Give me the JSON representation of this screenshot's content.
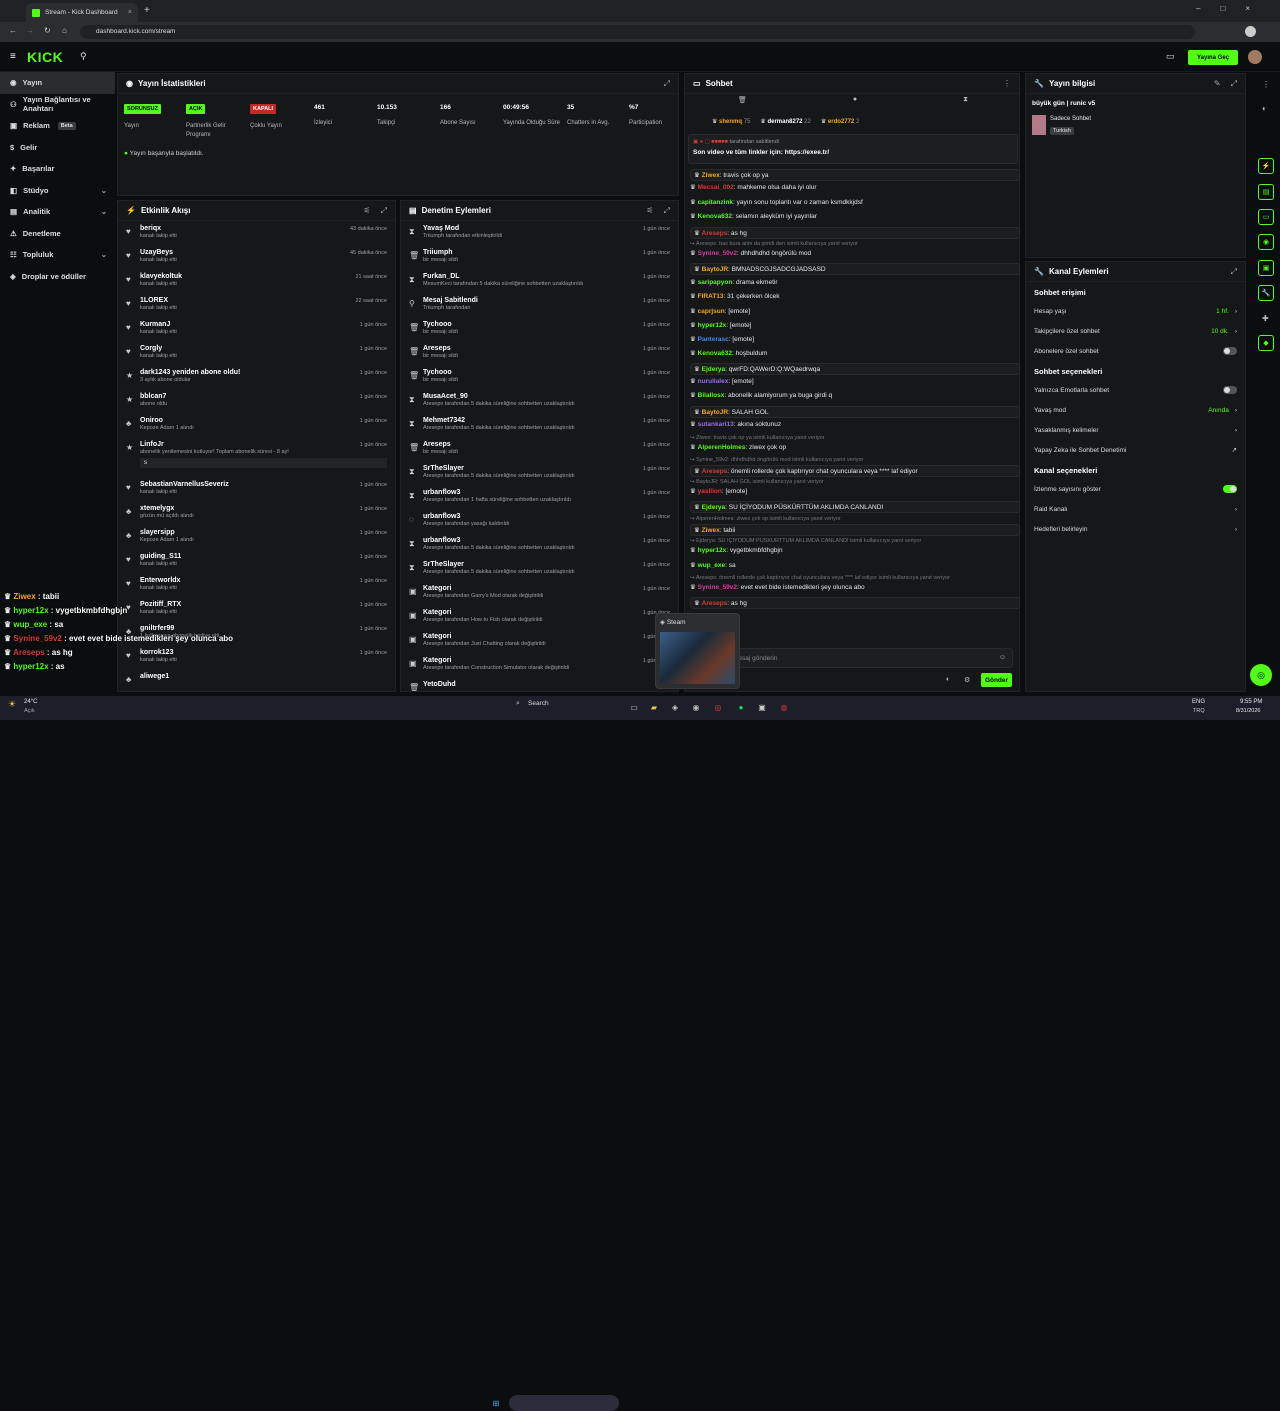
{
  "browser": {
    "tab_title": "Stream - Kick Dashboard",
    "url": "dashboard.kick.com/stream"
  },
  "header": {
    "logo": "KICK",
    "go_live": "Yayına Geç"
  },
  "sidebar": {
    "items": [
      {
        "label": "Yayın",
        "active": true
      },
      {
        "label": "Yayın Bağlantısı ve Anahtarı"
      },
      {
        "label": "Reklam",
        "badge": "Beta"
      },
      {
        "label": "Gelir"
      },
      {
        "label": "Başarılar"
      },
      {
        "label": "Stüdyo",
        "chevron": true
      },
      {
        "label": "Analitik",
        "chevron": true
      },
      {
        "label": "Denetleme"
      },
      {
        "label": "Topluluk",
        "chevron": true
      },
      {
        "label": "Droplar ve ödüller"
      }
    ]
  },
  "stats": {
    "title": "Yayın İstatistikleri",
    "status": "Yayın başarıyla başlatıldı.",
    "items": [
      {
        "value": "SORUNSUZ",
        "label": "Yayın",
        "kind": "green"
      },
      {
        "value": "AÇIK",
        "label": "Partnerlik Gelir Programı",
        "kind": "green"
      },
      {
        "value": "KAPALI",
        "label": "Çoklu Yayın",
        "kind": "red"
      },
      {
        "value": "461",
        "label": "İzleyici"
      },
      {
        "value": "10.153",
        "label": "Takipçi"
      },
      {
        "value": "166",
        "label": "Abone Sayısı"
      },
      {
        "value": "00:49:56",
        "label": "Yayında Olduğu Süre"
      },
      {
        "value": "35",
        "label": "Chatters in Avg."
      },
      {
        "value": "%7",
        "label": "Participation"
      }
    ]
  },
  "activity": {
    "title": "Etkinlik Akışı",
    "items": [
      {
        "name": "beriqx",
        "sub": "kanalı takip etti",
        "time": "43 dakika önce",
        "icon": "heart"
      },
      {
        "name": "UzayBeys",
        "sub": "kanalı takip etti",
        "time": "45 dakika önce",
        "icon": "heart"
      },
      {
        "name": "klavyekoltuk",
        "sub": "kanalı takip etti",
        "time": "21 saat önce",
        "icon": "heart"
      },
      {
        "name": "1LOREX",
        "sub": "kanalı takip etti",
        "time": "22 saat önce",
        "icon": "heart"
      },
      {
        "name": "KurmanJ",
        "sub": "kanalı takip etti",
        "time": "1 gün önce",
        "icon": "heart"
      },
      {
        "name": "Corgly",
        "sub": "kanalı takip etti",
        "time": "1 gün önce",
        "icon": "heart"
      },
      {
        "name": "dark1243 yeniden abone oldu!",
        "sub": "3 aylık abone oldular",
        "time": "1 gün önce",
        "icon": "star"
      },
      {
        "name": "bblcan7",
        "sub": "abone oldu",
        "time": "1 gün önce",
        "icon": "star"
      },
      {
        "name": "Oniroo",
        "sub": "Kepoze Adam 1 alındı",
        "time": "1 gün önce",
        "icon": "gift"
      },
      {
        "name": "LinfoJr",
        "sub": "abonelik yenilemesini kutluyor! Toplam abonelik süresi - 8 ay!",
        "time": "1 gün önce",
        "icon": "star",
        "msg": "s"
      },
      {
        "name": "SebastianVarnellusSeveriz",
        "sub": "kanalı takip etti",
        "time": "1 gün önce",
        "icon": "heart"
      },
      {
        "name": "xtemelygx",
        "sub": "gözün mü açıldı alındı",
        "time": "1 gün önce",
        "icon": "gift"
      },
      {
        "name": "slayersipp",
        "sub": "Kepoze Adam 1 alındı",
        "time": "1 gün önce",
        "icon": "gift"
      },
      {
        "name": "guiding_S11",
        "sub": "kanalı takip etti",
        "time": "1 gün önce",
        "icon": "heart"
      },
      {
        "name": "Enterworldx",
        "sub": "kanalı takip etti",
        "time": "1 gün önce",
        "icon": "heart"
      },
      {
        "name": "Pozitiff_RTX",
        "sub": "kanalı takip etti",
        "time": "1 gün önce",
        "icon": "heart"
      },
      {
        "name": "gniltrfer99",
        "sub": "1 kullanıcıya abonelik hediye etti.",
        "time": "1 gün önce",
        "icon": "gift"
      },
      {
        "name": "korrok123",
        "sub": "kanalı takip etti",
        "time": "1 gün önce",
        "icon": "heart"
      },
      {
        "name": "aliwege1",
        "sub": "",
        "time": "",
        "icon": "gift"
      }
    ]
  },
  "mod": {
    "title": "Denetim Eylemleri",
    "items": [
      {
        "name": "Yavaş Mod",
        "sub": "Triiumph tarafından etkinleştirildi",
        "time": "1 gün önce",
        "icon": "slow"
      },
      {
        "name": "Triiumph",
        "sub": "bir mesajı sildi",
        "time": "1 gün önce",
        "icon": "trash"
      },
      {
        "name": "Furkan_DL",
        "sub": "MesumKeci tarafından 5 dakika süreliğine sohbetten uzaklaştırıldı",
        "time": "1 gün önce",
        "icon": "timer"
      },
      {
        "name": "Mesaj Sabitlendi",
        "sub": "Triiumph tarafından",
        "time": "1 gün önce",
        "icon": "pin"
      },
      {
        "name": "Tychooo",
        "sub": "bir mesajı sildi",
        "time": "1 gün önce",
        "icon": "trash"
      },
      {
        "name": "Areseps",
        "sub": "bir mesajı sildi",
        "time": "1 gün önce",
        "icon": "trash"
      },
      {
        "name": "Tychooo",
        "sub": "bir mesajı sildi",
        "time": "1 gün önce",
        "icon": "trash"
      },
      {
        "name": "MusaAcet_90",
        "sub": "Areseps tarafından 5 dakika süreliğine sohbetten uzaklaştırıldı",
        "time": "1 gün önce",
        "icon": "timer"
      },
      {
        "name": "Mehmet7342",
        "sub": "Areseps tarafından 5 dakika süreliğine sohbetten uzaklaştırıldı",
        "time": "1 gün önce",
        "icon": "timer"
      },
      {
        "name": "Areseps",
        "sub": "bir mesajı sildi",
        "time": "1 gün önce",
        "icon": "trash"
      },
      {
        "name": "SrTheSlayer",
        "sub": "Areseps tarafından 5 dakika süreliğine sohbetten uzaklaştırıldı",
        "time": "1 gün önce",
        "icon": "timer"
      },
      {
        "name": "urbanflow3",
        "sub": "Areseps tarafından 1 hafta süreliğine sohbetten uzaklaştırıldı",
        "time": "1 gün önce",
        "icon": "timer"
      },
      {
        "name": "urbanflow3",
        "sub": "Areseps tarafından yasağı kaldırıldı",
        "time": "1 gün önce",
        "icon": "unban"
      },
      {
        "name": "urbanflow3",
        "sub": "Areseps tarafından 5 dakika süreliğine sohbetten uzaklaştırıldı",
        "time": "1 gün önce",
        "icon": "timer"
      },
      {
        "name": "SrTheSlayer",
        "sub": "Areseps tarafından 5 dakika süreliğine sohbetten uzaklaştırıldı",
        "time": "1 gün önce",
        "icon": "timer"
      },
      {
        "name": "Kategori",
        "sub": "Areseps tarafından Garry's Mod olarak değiştirildi",
        "time": "1 gün önce",
        "icon": "cat"
      },
      {
        "name": "Kategori",
        "sub": "Areseps tarafından How to Fish olarak değiştirildi",
        "time": "1 gün önce",
        "icon": "cat"
      },
      {
        "name": "Kategori",
        "sub": "Areseps tarafından Just Chatting olarak değiştirildi",
        "time": "1 gün önce",
        "icon": "cat"
      },
      {
        "name": "Kategori",
        "sub": "Areseps tarafından Construction Simulator olarak değiştirildi",
        "time": "1 gün önce",
        "icon": "cat"
      },
      {
        "name": "YetoDuhd",
        "sub": "",
        "time": "",
        "icon": "trash"
      }
    ]
  },
  "chat": {
    "title": "Sohbet",
    "top": [
      {
        "name": "shenmq",
        "n": "75",
        "color": "#f5a623"
      },
      {
        "name": "derman8272",
        "n": "22",
        "color": "#fff"
      },
      {
        "name": "erdo2772",
        "n": "2",
        "color": "#f5a623"
      }
    ],
    "pinned_by": "tarafından sabitlendi",
    "pinned": "Son video ve tüm linkler için: https://exee.tr/",
    "messages": [
      {
        "u": "Ziwex",
        "c": "#f5a623",
        "m": "travis çok op ya",
        "hl": true
      },
      {
        "u": "Mecsai_002",
        "c": "#d63a3a",
        "m": "mahkeme olsa daha iyi olur"
      },
      {
        "u": "capitanzink",
        "c": "#53fc18",
        "m": "yayın sonu toplantı var o zaman ksmdkkjdsf"
      },
      {
        "u": "Kenova632",
        "c": "#53fc18",
        "m": "selamın aleyküm iyi yayınlar"
      },
      {
        "u": "Areseps",
        "c": "#d63a3a",
        "m": "as hg",
        "hl": true
      },
      {
        "sys": "Areseps: bas bura atim da şimdi den isimli kullanıcıya yanıt veriyor"
      },
      {
        "u": "Synine_59v2",
        "c": "#d63aa6",
        "m": "dhhdhdhd öngörülü mod"
      },
      {
        "u": "BaytoJR",
        "c": "#f5a623",
        "m": "BMNADSCGJSADCGJADSASD",
        "hl": true
      },
      {
        "u": "saripapyon",
        "c": "#53fc18",
        "m": "drama ekmetir"
      },
      {
        "u": "FIRAT13",
        "c": "#f5a623",
        "m": "31 çekerken ölcek"
      },
      {
        "u": "caprjsun",
        "c": "#f5a623",
        "m": "[emote]"
      },
      {
        "u": "hyper12x",
        "c": "#53fc18",
        "m": "[emote]"
      },
      {
        "u": "Panterasc",
        "c": "#3a8cf5",
        "m": "[emote]"
      },
      {
        "u": "Kenova632",
        "c": "#53fc18",
        "m": "hoşbuldum"
      },
      {
        "u": "Ejderya",
        "c": "#53fc18",
        "m": "qwrFD:QAWerD:Q:WQaedrwqa",
        "hl": true
      },
      {
        "u": "nurullalex",
        "c": "#9b6bf5",
        "m": "[emote]"
      },
      {
        "u": "Bilallosx",
        "c": "#53fc18",
        "m": "abonelik alamiyorum ya buga girdi q"
      },
      {
        "u": "BaytoJR",
        "c": "#f5a623",
        "m": "SALAH GOL",
        "hl": true
      },
      {
        "u": "sutankari13",
        "c": "#9b6bf5",
        "m": "akına soktunuz"
      },
      {
        "sys": "Ziwex: travis çok op ya isimli kullanıcıya yanıt veriyor"
      },
      {
        "u": "AlperenHolmes",
        "c": "#53fc18",
        "m": "ziwex çok op"
      },
      {
        "sys": "Synine_59v2: dhhdhdhd öngörülü mod isimli kullanıcıya yanıt veriyor"
      },
      {
        "u": "Areseps",
        "c": "#d63a3a",
        "m": "önemli rollerde çok kaptırıyor chat oyunculara veya **** laf ediyor",
        "hl": true
      },
      {
        "sys": "BaytoJR: SALAH GOL isimli kullanıcıya yanıt veriyor"
      },
      {
        "u": "yasllion",
        "c": "#d63a3a",
        "m": "[emote]"
      },
      {
        "u": "Ejderya",
        "c": "#53fc18",
        "m": "SU İÇİYODUM PÜSKÜRTTÜM AKLIMDA CANLANDI",
        "hl": true
      },
      {
        "sys": "AlperenHolmes: ziwex çok op isimli kullanıcıya yanıt veriyor"
      },
      {
        "u": "Ziwex",
        "c": "#f5a623",
        "m": "tabii",
        "hl": true
      },
      {
        "sys": "Ejderya: SU İÇİYODUM PÜSKÜRTTÜM AKLIMDA CANLANDI isimli kullanıcıya yanıt veriyor"
      },
      {
        "u": "hyper12x",
        "c": "#53fc18",
        "m": "vygetbkmbfdhgbjn"
      },
      {
        "u": "wup_exe",
        "c": "#53fc18",
        "m": "sa"
      },
      {
        "sys": "Areseps: önemli rollerde çok kaptırıyor chat oyunculara veya **** laf ediyor isimli kullanıcıya yanıt veriyor"
      },
      {
        "u": "Synine_59v2",
        "c": "#d63aa6",
        "m": "evet evet bide istemedikleri şey olunca abo"
      },
      {
        "u": "Areseps",
        "c": "#d63a3a",
        "m": "as hg",
        "hl": true
      },
      {
        "u": "wup_exe",
        "c": "#53fc18",
        "m": "sa"
      }
    ],
    "input_placeholder": "Mesaj gönderin",
    "send": "Gönder"
  },
  "info": {
    "title": "Yayın bilgisi",
    "stream_title": "büyük gün | runic v5",
    "category": "Sadece Sohbet",
    "tag": "Turkish"
  },
  "channel": {
    "title": "Kanal Eylemleri",
    "chat_access": "Sohbet erişimi",
    "rows1": [
      {
        "label": "Hesap yaşı",
        "value": "1 hf."
      },
      {
        "label": "Takipçilere özel sohbet",
        "value": "10 dk."
      },
      {
        "label": "Abonelere özel sohbet",
        "toggle": false
      }
    ],
    "chat_options": "Sohbet seçenekleri",
    "rows2": [
      {
        "label": "Yalnızca Emotlarla sohbet",
        "toggle": false
      },
      {
        "label": "Yavaş mod",
        "value": "Anında"
      },
      {
        "label": "Yasaklanmış kelimeler",
        "value": ""
      },
      {
        "label": "Yapay Zeka ile Sohbet Denetimi",
        "value": ""
      }
    ],
    "channel_options": "Kanal seçenekleri",
    "rows3": [
      {
        "label": "İzlenme sayısını göster",
        "toggle": true
      },
      {
        "label": "Raid Kanalı",
        "value": ""
      },
      {
        "label": "Hedefleri belirleyin",
        "value": ""
      }
    ]
  },
  "overlay": [
    {
      "u": "Ziwex",
      "c": "#f5a623",
      "m": "tabii"
    },
    {
      "u": "hyper12x",
      "c": "#53fc18",
      "m": "vygetbkmbfdhgbjn"
    },
    {
      "u": "wup_exe",
      "c": "#53fc18",
      "m": "sa"
    },
    {
      "u": "Synine_59v2",
      "c": "#d63a3a",
      "m": "evet evet bide istemedikleri şey olunca abo"
    },
    {
      "u": "Areseps",
      "c": "#d63a3a",
      "m": "as hg"
    },
    {
      "u": "hyper12x",
      "c": "#53fc18",
      "m": "as"
    }
  ],
  "steam_popup": "Steam",
  "taskbar": {
    "weather": "24°C",
    "weather_sub": "Açık",
    "search": "Search",
    "lang": "ENG",
    "lang2": "TRQ",
    "time": "9:55 PM",
    "date": "8/31/2026"
  }
}
